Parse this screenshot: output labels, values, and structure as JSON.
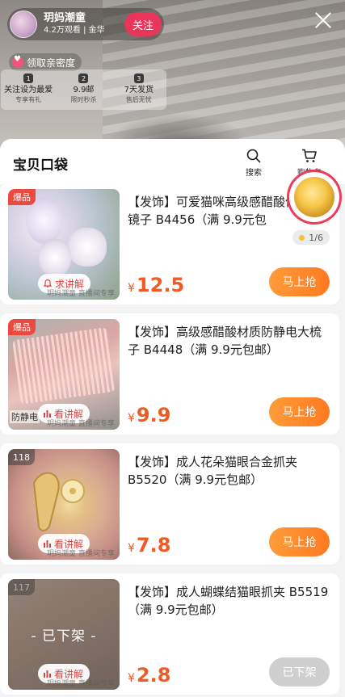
{
  "live": {
    "streamer_name": "玥妈潮童",
    "stats": "4.2万观看 | 金华",
    "follow_label": "关注",
    "intimacy_label": "领取亲密度",
    "fan_steps": [
      {
        "num": "1",
        "title": "关注设为最爱",
        "sub": "专享有礼"
      },
      {
        "num": "2",
        "title": "9.9邮",
        "sub": "限时秒杀"
      },
      {
        "num": "3",
        "title": "7天发货",
        "sub": "售后无忧"
      }
    ]
  },
  "sheet": {
    "title": "宝贝口袋",
    "search_label": "搜索",
    "cart_label": "购物车"
  },
  "products": [
    {
      "badge": "爆品",
      "title": "【发饰】可爱猫咪高级感醋酸便捷式镜子 B4456（满 9.9元包",
      "explain_label": "求讲解",
      "price_symbol": "¥",
      "price": "12.5",
      "buy_label": "马上抢",
      "watermark": "玥妈潮童 直播间专享",
      "pager": "1/6"
    },
    {
      "badge": "爆品",
      "title": "【发饰】高级感醋酸材质防静电大梳子 B4448（满 9.9元包邮）",
      "explain_label": "看讲解",
      "price_symbol": "¥",
      "price": "9.9",
      "buy_label": "马上抢",
      "watermark": "玥妈潮童 直播间专享",
      "thumb_text": "防静电"
    },
    {
      "badge": "118",
      "title": "【发饰】成人花朵猫眼合金抓夹 B5520（满 9.9元包邮）",
      "explain_label": "看讲解",
      "price_symbol": "¥",
      "price": "7.8",
      "buy_label": "马上抢",
      "watermark": "玥妈潮童 直播间专享"
    },
    {
      "badge": "117",
      "title": "【发饰】成人蝴蝶结猫眼抓夹 B5519（满 9.9元包邮）",
      "explain_label": "看讲解",
      "price_symbol": "¥",
      "price": "2.8",
      "buy_label": "已下架",
      "offshelf_label": "- 已下架 -",
      "watermark": "玥妈潮童 直播间专享"
    }
  ]
}
